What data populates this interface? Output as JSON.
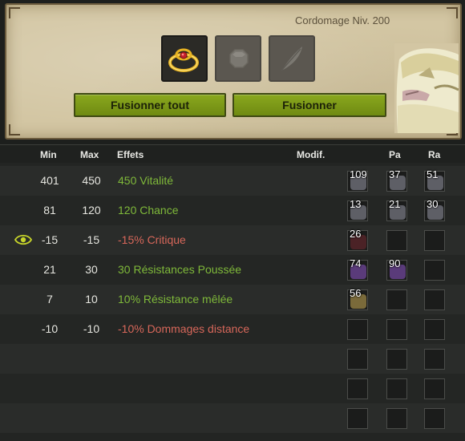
{
  "forge": {
    "job_label": "Cordomage Niv. 200",
    "fuse_all_label": "Fusionner tout",
    "fuse_label": "Fusionner"
  },
  "table": {
    "headers": {
      "min": "Min",
      "max": "Max",
      "effects": "Effets",
      "modif": "Modif.",
      "pa": "Pa",
      "ra": "Ra"
    },
    "rows": [
      {
        "min": "401",
        "max": "450",
        "effect": "450 Vitalité",
        "type": "pos",
        "runes": [
          "109",
          "37",
          "51"
        ]
      },
      {
        "min": "81",
        "max": "120",
        "effect": "120 Chance",
        "type": "pos",
        "runes": [
          "13",
          "21",
          "30"
        ]
      },
      {
        "min": "-15",
        "max": "-15",
        "effect": "-15% Critique",
        "type": "neg",
        "runes": [
          "26",
          "",
          ""
        ]
      },
      {
        "min": "21",
        "max": "30",
        "effect": "30 Résistances Poussée",
        "type": "pos",
        "runes": [
          "74",
          "90",
          ""
        ]
      },
      {
        "min": "7",
        "max": "10",
        "effect": "10% Résistance mêlée",
        "type": "pos",
        "runes": [
          "56",
          "",
          ""
        ]
      },
      {
        "min": "-10",
        "max": "-10",
        "effect": "-10% Dommages distance",
        "type": "neg",
        "runes": [
          "",
          "",
          ""
        ]
      },
      {
        "min": "",
        "max": "",
        "effect": "",
        "type": "empty",
        "runes": [
          "",
          "",
          ""
        ]
      },
      {
        "min": "",
        "max": "",
        "effect": "",
        "type": "empty",
        "runes": [
          "",
          "",
          ""
        ]
      },
      {
        "min": "",
        "max": "",
        "effect": "",
        "type": "empty",
        "runes": [
          "",
          "",
          ""
        ]
      }
    ]
  },
  "colors": {
    "positive": "#7fb93a",
    "negative": "#d7675a",
    "button": "#7e9b19"
  }
}
